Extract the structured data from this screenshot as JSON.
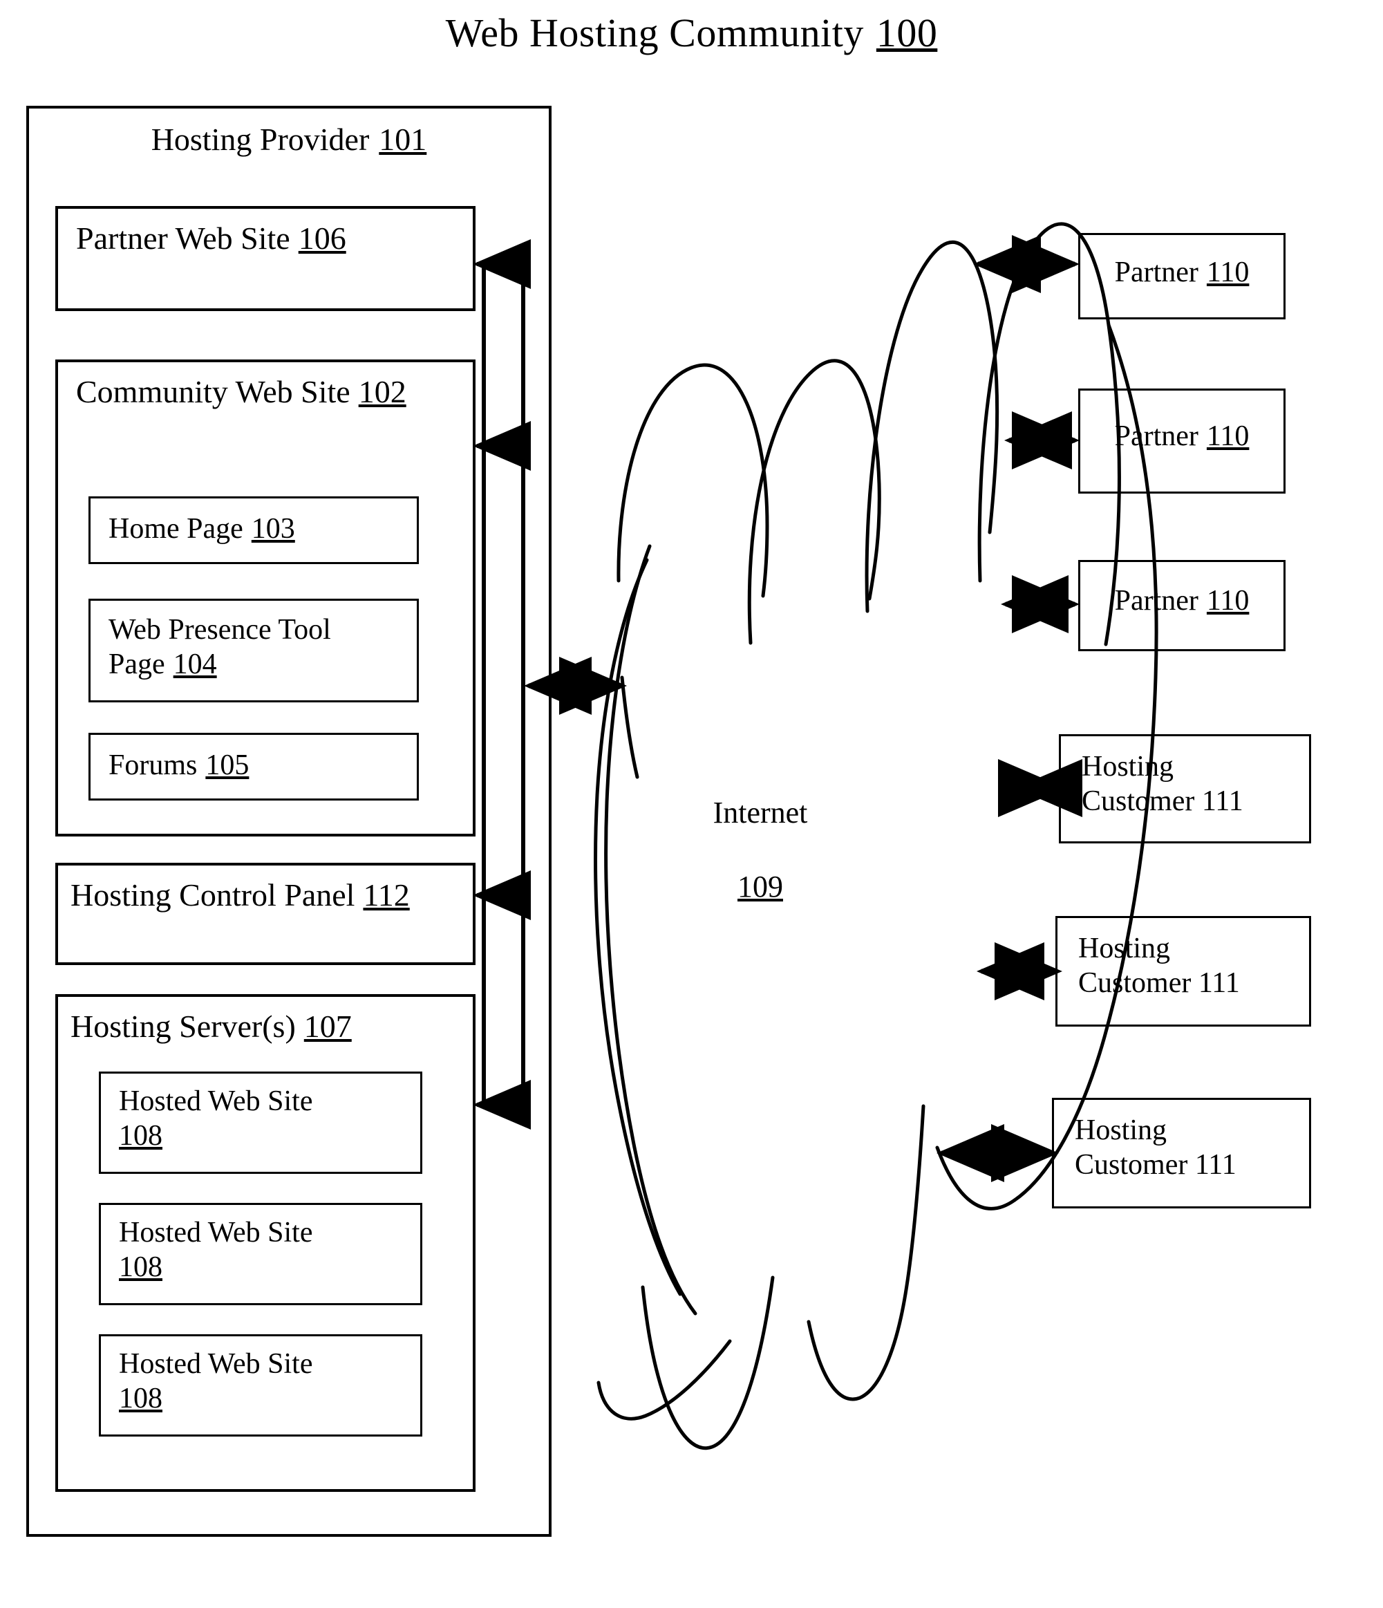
{
  "figure": {
    "title": "Web Hosting Community 100",
    "title_text": "Web Hosting Community",
    "title_ref": "100"
  },
  "hosting_provider": {
    "label": "Hosting Provider",
    "ref": "101",
    "children": {
      "partner_web_site": {
        "label": "Partner Web Site",
        "ref": "106"
      },
      "community_web_site": {
        "label": "Community Web Site",
        "ref": "102",
        "children": {
          "home_page": {
            "label": "Home Page",
            "ref": "103"
          },
          "web_presence_tool_page": {
            "label": "Web Presence Tool\nPage",
            "ref": "104"
          },
          "forums": {
            "label": "Forums",
            "ref": "105"
          }
        }
      },
      "hosting_control_panel": {
        "label": "Hosting Control Panel",
        "ref": "112"
      },
      "hosting_servers": {
        "label": "Hosting Server(s)",
        "ref": "107",
        "children": [
          {
            "label": "Hosted Web Site",
            "ref": "108"
          },
          {
            "label": "Hosted Web Site",
            "ref": "108"
          },
          {
            "label": "Hosted Web Site",
            "ref": "108"
          }
        ]
      }
    }
  },
  "internet": {
    "label": "Internet",
    "ref": "109"
  },
  "external_nodes": [
    {
      "label": "Partner",
      "ref": "110",
      "two_line": false
    },
    {
      "label": "Partner",
      "ref": "110",
      "two_line": false
    },
    {
      "label": "Partner",
      "ref": "110",
      "two_line": false
    },
    {
      "label": "Hosting\nCustomer 111",
      "ref": "",
      "two_line": true
    },
    {
      "label": "Hosting\nCustomer 111",
      "ref": "",
      "two_line": true
    },
    {
      "label": "Hosting\nCustomer 111",
      "ref": "",
      "two_line": true
    }
  ],
  "colors": {
    "stroke": "#000000",
    "background": "#ffffff"
  }
}
